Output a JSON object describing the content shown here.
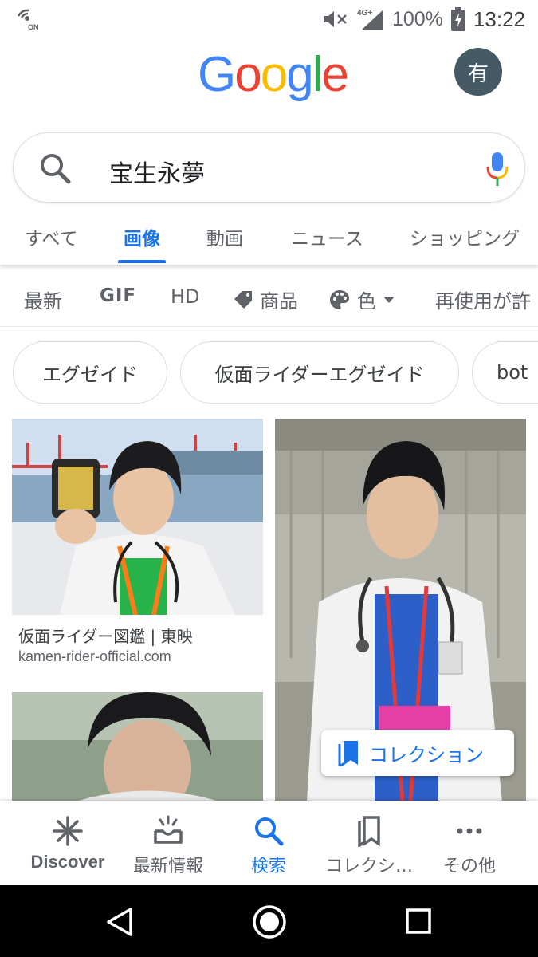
{
  "status_bar": {
    "battery": "100%",
    "time": "13:22",
    "network": "4G+",
    "icons": [
      "vibrate-on-icon",
      "mute-icon",
      "signal-icon",
      "battery-charging-icon"
    ]
  },
  "header": {
    "logo": "Google",
    "avatar_letter": "有"
  },
  "search": {
    "query": "宝生永夢"
  },
  "tabs": [
    {
      "label": "すべて",
      "active": false
    },
    {
      "label": "画像",
      "active": true
    },
    {
      "label": "動画",
      "active": false
    },
    {
      "label": "ニュース",
      "active": false
    },
    {
      "label": "ショッピング",
      "active": false
    }
  ],
  "filters": {
    "latest": "最新",
    "gif": "GIF",
    "hd": "HD",
    "products": "商品",
    "color": "色",
    "reuse": "再使用が許"
  },
  "chips": [
    "エグゼイド",
    "仮面ライダーエグゼイド",
    "bot"
  ],
  "results": [
    {
      "caption": "仮面ライダー図鑑 | 東映",
      "domain": "kamen-rider-official.com"
    }
  ],
  "collection_button": "コレクション",
  "bottom_nav": [
    {
      "label": "Discover",
      "icon": "asterisk-icon"
    },
    {
      "label": "最新情報",
      "icon": "updates-icon"
    },
    {
      "label": "検索",
      "icon": "search-icon",
      "active": true
    },
    {
      "label": "コレクシ…",
      "icon": "collections-icon"
    },
    {
      "label": "その他",
      "icon": "more-icon"
    }
  ],
  "colors": {
    "accent": "#1a73e8",
    "google_blue": "#4285f4",
    "google_red": "#ea4335",
    "google_yellow": "#fbbc05",
    "google_green": "#34a853",
    "avatar_bg": "#455a64"
  }
}
